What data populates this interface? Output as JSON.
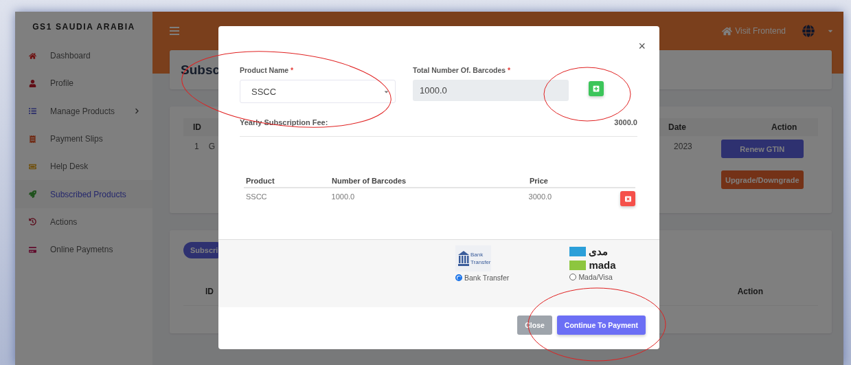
{
  "brand": "GS1 SAUDIA ARABIA",
  "sidebar": {
    "items": [
      {
        "label": "Dashboard",
        "selected": false,
        "expandable": false
      },
      {
        "label": "Profile",
        "selected": false,
        "expandable": false
      },
      {
        "label": "Manage Products",
        "selected": false,
        "expandable": true
      },
      {
        "label": "Payment Slips",
        "selected": false,
        "expandable": false
      },
      {
        "label": "Help Desk",
        "selected": false,
        "expandable": false
      },
      {
        "label": "Subscribed Products",
        "selected": true,
        "expandable": false
      },
      {
        "label": "Actions",
        "selected": false,
        "expandable": false
      },
      {
        "label": "Online Paymetns",
        "selected": false,
        "expandable": false
      }
    ]
  },
  "header": {
    "link": "Visit Frontend"
  },
  "page": {
    "title": "Subsc",
    "subscriptions": {
      "columns": [
        "ID",
        "Date",
        "Action"
      ],
      "row": {
        "id": "1",
        "product": "G",
        "date": "2023",
        "actions": [
          "Renew GTIN",
          "Upgrade/Downgrade"
        ]
      }
    },
    "second_card": {
      "button": "Subscri",
      "columns": [
        "ID",
        "Action"
      ]
    }
  },
  "modal": {
    "close_symbol": "×",
    "fields": [
      {
        "label": "Product Name",
        "required_mark": "*",
        "kind": "select",
        "value": "SSCC"
      },
      {
        "label": "Total Number Of. Barcodes",
        "required_mark": "*",
        "kind": "readonly",
        "value": "1000.0"
      }
    ],
    "fee": {
      "label": "Yearly Subscription Fee:",
      "value": "3000.0"
    },
    "table": {
      "columns": [
        "Product",
        "Number of Barcodes",
        "Price"
      ],
      "rows": [
        [
          "SSCC",
          "1000.0",
          "3000.0"
        ]
      ]
    },
    "payment_options": [
      {
        "kind": "bank",
        "logo_text": [
          "Bank",
          "Transfer"
        ],
        "label": "Bank Transfer",
        "selected": true
      },
      {
        "kind": "mada",
        "logo_text": [
          "مدى",
          "mada"
        ],
        "label": "Mada/Visa",
        "selected": false
      }
    ],
    "buttons": [
      {
        "label": "Close",
        "kind": "secondary"
      },
      {
        "label": "Continue To Payment",
        "kind": "primary"
      }
    ]
  }
}
